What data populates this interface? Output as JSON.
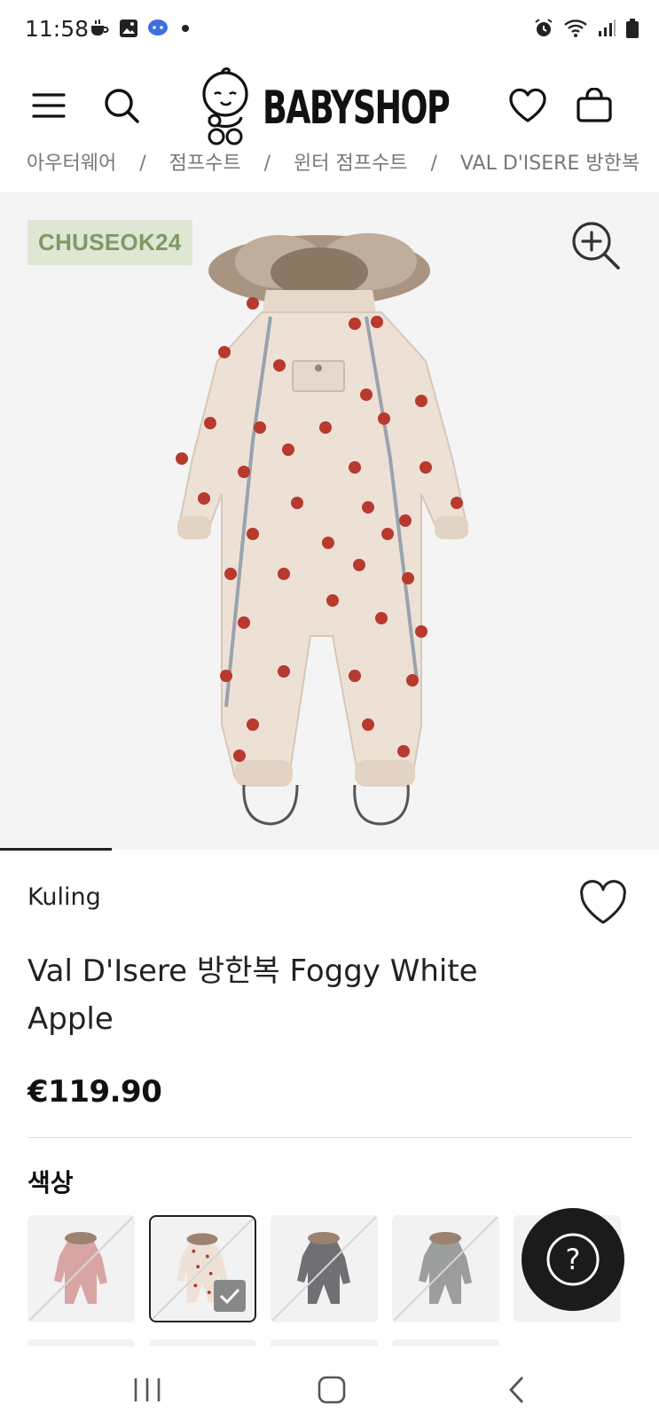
{
  "status_bar": {
    "time": "11:58",
    "left_icons": [
      "coffee-icon",
      "gallery-icon",
      "messenger-icon",
      "dot-icon"
    ],
    "right_icons": [
      "alarm-icon",
      "wifi-icon",
      "signal-icon",
      "battery-icon"
    ]
  },
  "header": {
    "logo_text": "BABYSHOP",
    "icons": [
      "menu-icon",
      "search-icon",
      "heart-icon",
      "bag-icon"
    ]
  },
  "breadcrumb": [
    "아우터웨어",
    "점프수트",
    "윈터 점프수트",
    "VAL D'ISERE 방한복"
  ],
  "gallery": {
    "promo_code": "CHUSEOK24",
    "zoom_icon": "zoom-in-icon",
    "image_alt": "Apple print winter snowsuit"
  },
  "product": {
    "brand": "Kuling",
    "title": "Val D'Isere 방한복 Foggy White Apple",
    "price": "€119.90"
  },
  "color_section": {
    "label": "색상",
    "options": [
      {
        "name": "Pink",
        "color": "#d9a4a4"
      },
      {
        "name": "Foggy White Apple",
        "color": "#eee2d8",
        "selected": true
      },
      {
        "name": "Dark Grey",
        "color": "#6e7074"
      },
      {
        "name": "Grey",
        "color": "#9b9e9c"
      },
      {
        "name": "Light",
        "color": "#f2f2f2"
      }
    ]
  },
  "help_button": {
    "label": "?"
  },
  "colors": {
    "accent": "#111111",
    "promo_bg": "#dfe6d4",
    "promo_text": "#7d9a63",
    "suit": "#ede1d6",
    "apple": "#b8392e"
  }
}
